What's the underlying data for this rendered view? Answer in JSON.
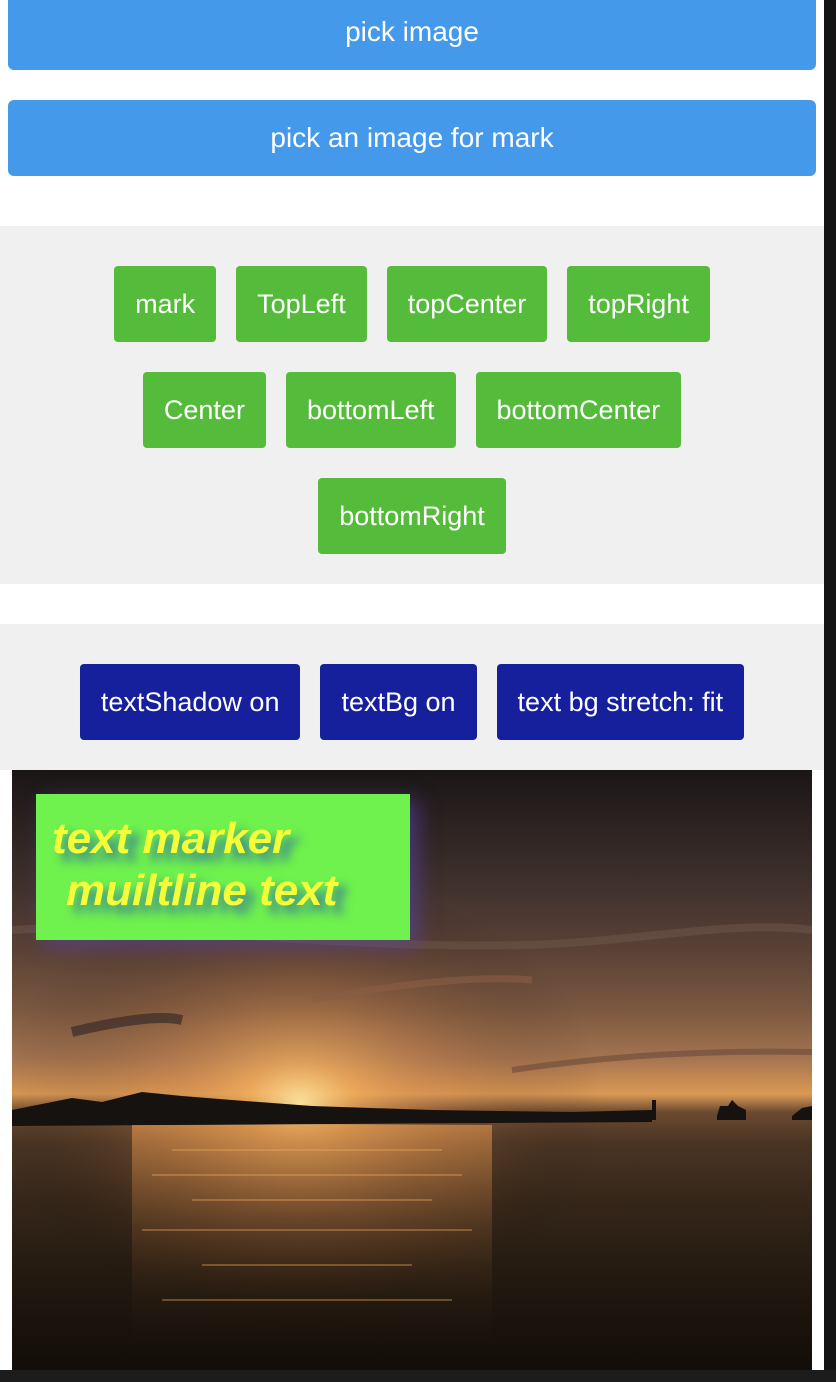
{
  "buttons": {
    "pick_image": "pick image",
    "pick_mark_image": "pick an image for mark"
  },
  "positions": {
    "row1": [
      "mark",
      "TopLeft",
      "topCenter",
      "topRight"
    ],
    "row2": [
      "Center",
      "bottomLeft",
      "bottomCenter"
    ],
    "row3": [
      "bottomRight"
    ]
  },
  "text_options": {
    "shadow": "textShadow on",
    "bg": "textBg on",
    "stretch": "text bg stretch: fit"
  },
  "preview": {
    "marker_lines": [
      "text marker",
      "muiltline text"
    ]
  },
  "colors": {
    "primary_button": "#4599ea",
    "position_button": "#55bb3a",
    "text_option_button": "#16209c",
    "panel_background": "#f0f0f0",
    "marker_background": "#6ff24d",
    "marker_text": "#f4ff39"
  }
}
